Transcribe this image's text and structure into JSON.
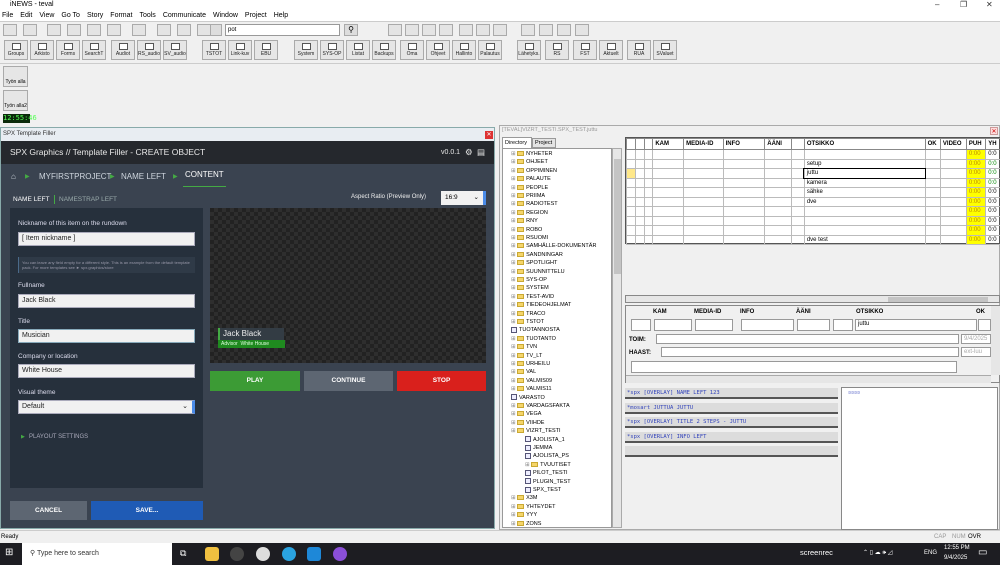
{
  "window": {
    "title": "iNEWS - teval",
    "min": "–",
    "restore": "❐",
    "close": "✕"
  },
  "menu": [
    "File",
    "Edit",
    "View",
    "Go To",
    "Story",
    "Format",
    "Tools",
    "Communicate",
    "Window",
    "Project",
    "Help"
  ],
  "toolbar": {
    "search_value": "pot"
  },
  "buttons_row": [
    "Groups",
    "Arkisto",
    "Forms",
    "SearchT",
    "Audiot",
    "RS_audio",
    "SV_audio",
    "TSTOT",
    "Link-kuv",
    "EBU",
    "System",
    "SYS-OP",
    "Listat",
    "Backups",
    "Oma",
    "Ohjeet",
    "Hallinto",
    "Palautus",
    "Lähetyks.",
    "RS",
    "FST",
    "Aktuelt",
    "RUA",
    "SValuet"
  ],
  "left_buttons": [
    "Työn alla",
    "Työn alla2"
  ],
  "clock": "12:55:46",
  "spx": {
    "window_title": "SPX Template Filler",
    "header": "SPX Graphics // Template Filler - CREATE OBJECT",
    "version": "v0.0.1",
    "breadcrumb": [
      "MYFIRSTPROJECT",
      "NAME LEFT",
      "CONTENT"
    ],
    "tabs": [
      "NAME LEFT",
      "NAMESTRAP LEFT"
    ],
    "aspect_label": "Aspect Ratio (Preview Only)",
    "aspect_value": "16:9",
    "nickname_label": "Nickname of this item on the rundown",
    "nickname_value": "[ Item nickname ]",
    "info": "You can leave any field empty for a different style. This is an example from the default template pack. For more templates see ► spx.graphics/store",
    "fullname_label": "Fullname",
    "fullname_value": "Jack Black",
    "title_label": "Title",
    "title_value": "Musician",
    "company_label": "Company or location",
    "company_value": "White House",
    "theme_label": "Visual theme",
    "theme_value": "Default",
    "playout": "PLAYOUT SETTINGS",
    "preview_name": "Jack Black",
    "preview_title": "Advisor",
    "preview_company": "White House",
    "play": "PLAY",
    "continue": "CONTINUE",
    "stop": "STOP",
    "cancel": "CANCEL",
    "save": "SAVE..."
  },
  "story": {
    "title": "[TEVAL]VIZRT_TESTI.SPX_TEST.juttu",
    "tabs": [
      "Directory",
      "Project"
    ],
    "tree": [
      {
        "n": "NYHETER",
        "t": "f"
      },
      {
        "n": "OHJEET",
        "t": "f"
      },
      {
        "n": "OPPIMINEN",
        "t": "f"
      },
      {
        "n": "PALAUTE",
        "t": "f"
      },
      {
        "n": "PEOPLE",
        "t": "f"
      },
      {
        "n": "PRIIMA",
        "t": "f"
      },
      {
        "n": "RADIOTEST",
        "t": "f"
      },
      {
        "n": "REGION",
        "t": "f"
      },
      {
        "n": "RNY",
        "t": "f"
      },
      {
        "n": "ROBO",
        "t": "f"
      },
      {
        "n": "RSUOMI",
        "t": "f"
      },
      {
        "n": "SAMHÄLLE-DOKUMENTÄR",
        "t": "f"
      },
      {
        "n": "SANDNINGAR",
        "t": "f"
      },
      {
        "n": "SPOTLIGHT",
        "t": "f"
      },
      {
        "n": "SUUNNITTELU",
        "t": "f"
      },
      {
        "n": "SYS-OP",
        "t": "f"
      },
      {
        "n": "SYSTEM",
        "t": "f"
      },
      {
        "n": "TEST-AVID",
        "t": "f"
      },
      {
        "n": "TIEDEOHJELMAT",
        "t": "f"
      },
      {
        "n": "TRACO",
        "t": "f"
      },
      {
        "n": "TSTOT",
        "t": "f"
      },
      {
        "n": "TUOTANNOSTA",
        "t": "d"
      },
      {
        "n": "TUOTANTO",
        "t": "f"
      },
      {
        "n": "TVN",
        "t": "f"
      },
      {
        "n": "TV_LT",
        "t": "f"
      },
      {
        "n": "URHEILU",
        "t": "f"
      },
      {
        "n": "VAL",
        "t": "f"
      },
      {
        "n": "VALMIS09",
        "t": "f"
      },
      {
        "n": "VALMIS11",
        "t": "f"
      },
      {
        "n": "VARASTO",
        "t": "d"
      },
      {
        "n": "VARDAGSFAKTA",
        "t": "f"
      },
      {
        "n": "VEGA",
        "t": "f"
      },
      {
        "n": "VIIHDE",
        "t": "f"
      },
      {
        "n": "VIZRT_TESTI",
        "t": "f"
      },
      {
        "n": "AJOLISTA_1",
        "t": "d",
        "i": 1
      },
      {
        "n": "JEMMA",
        "t": "d",
        "i": 1
      },
      {
        "n": "AJOLISTA_PS",
        "t": "d",
        "i": 1
      },
      {
        "n": "TVUUTISET",
        "t": "f",
        "i": 1
      },
      {
        "n": "PILOT_TESTI",
        "t": "d",
        "i": 1
      },
      {
        "n": "PLUGIN_TEST",
        "t": "d",
        "i": 1
      },
      {
        "n": "SPX_TEST",
        "t": "d",
        "i": 1
      },
      {
        "n": "X3M",
        "t": "f"
      },
      {
        "n": "YHTEYDET",
        "t": "f"
      },
      {
        "n": "YYY",
        "t": "f"
      },
      {
        "n": "ZONS",
        "t": "f"
      }
    ],
    "columns": [
      "",
      "",
      "",
      "KAM",
      "MEDIA-ID",
      "INFO",
      "ÄÄNI",
      "",
      "OTSIKKO",
      "OK",
      "VIDEO",
      "PUH",
      "YH"
    ],
    "rows": [
      {
        "otsikko": "",
        "puh": "0:00",
        "yh": "0:0"
      },
      {
        "otsikko": "setup",
        "puh": "0:00",
        "yh": "0:0"
      },
      {
        "otsikko": "juttu",
        "puh": "0:00",
        "yh": "0:0"
      },
      {
        "otsikko": "kamera",
        "puh": "0:00",
        "yh": "0:0"
      },
      {
        "otsikko": "sähke",
        "puh": "0:00",
        "yh": "0:0"
      },
      {
        "otsikko": "dve",
        "puh": "0:00",
        "yh": "0:0"
      },
      {
        "otsikko": "",
        "puh": "0:00",
        "yh": "0:0"
      },
      {
        "otsikko": "",
        "puh": "0:00",
        "yh": "0:0"
      },
      {
        "otsikko": "",
        "puh": "0:00",
        "yh": "0:0"
      },
      {
        "otsikko": "dve test",
        "puh": "0:00",
        "yh": "0:0"
      }
    ],
    "form": {
      "labels": [
        "KAM",
        "MEDIA-ID",
        "INFO",
        "ÄÄNI",
        "OTSIKKO",
        "OK"
      ],
      "otsikko": "juttu",
      "toim": "TOIM:",
      "haast": "HAAST:",
      "date": "9/4/2025",
      "ext": "ext-luu"
    },
    "scripts": [
      "*spx [OVERLAY] NAME LEFT 123",
      "*mosart JUTTUA JUTTU",
      "*spx [OVERLAY] TITLE 2 STEPS - JUTTU",
      "*spx [OVERLAY] INFO LEFT"
    ],
    "script_box": "¤¤¤¤"
  },
  "statusbar": {
    "text": "Ready",
    "cap": "CAP",
    "num": "NUM",
    "ovr": "OVR"
  },
  "taskbar": {
    "search": "Type here to search",
    "screenrec": "screenrec",
    "lang": "ENG",
    "time": "12:55 PM",
    "date": "9/4/2025"
  }
}
